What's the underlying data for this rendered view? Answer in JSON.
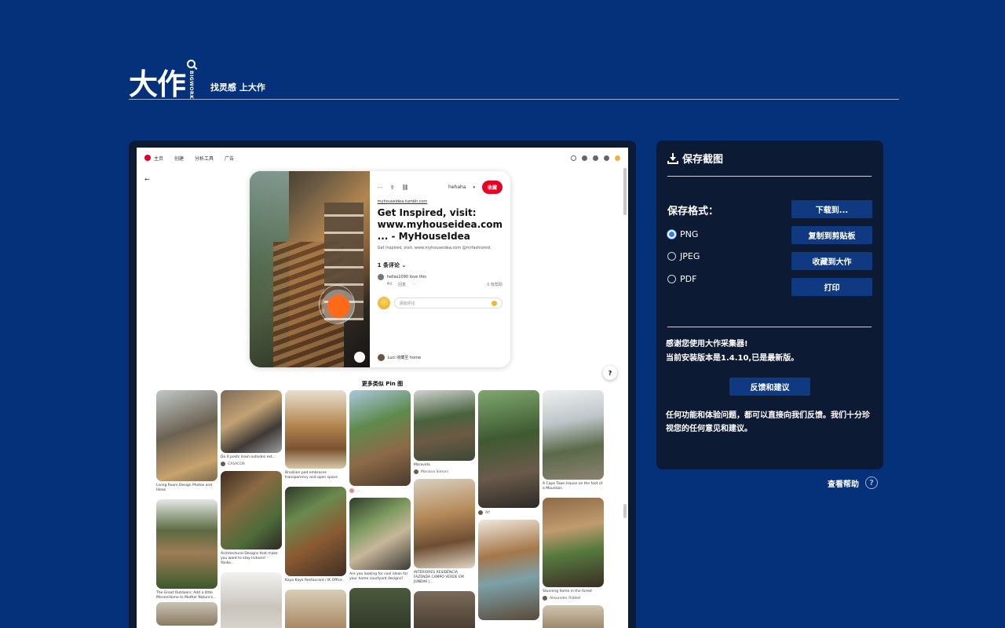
{
  "header": {
    "logo_text": "大作",
    "logo_vertical": "BIGWORK",
    "slogan": "找灵感 上大作"
  },
  "preview": {
    "topbar": {
      "nav": [
        "主页",
        "创建",
        "分析工具",
        "广告"
      ]
    },
    "pin": {
      "board": "hehaha",
      "save_label": "收藏",
      "link": "myhouseidea.tumblr.com",
      "title": "Get Inspired, visit: www.myhouseidea.com ... - MyHouseIdea",
      "description": "Get Inspired, visit: www.myhouseidea.com @mrfashionist",
      "comments_heading": "1 条评论",
      "comment_user": "hellas1090 love this",
      "comment_meta": [
        "4d",
        "回复"
      ],
      "comment_like": "0 有帮助",
      "add_placeholder": "添加评论",
      "owner": "Luci 收藏至 home"
    },
    "more_title": "更多类似 Pin 图",
    "grid": {
      "captions": [
        "Living Room Design Photos and Ideas",
        "The Great Outdoors: Add a little MissenHome to Mother Nature's...",
        "Do it posts main outsides ext...",
        "CASACOR",
        "Architectural Designs that make you want to stay Indoors! - Yanko...",
        "Brazilian pad embraces transparency and open space",
        "Kaya Kaya Restaurant / IK Office",
        "Are you looking for cool ideas for your home courtyard designs?",
        "Mariana Simoni",
        "Maravida",
        "INTERIORES RESIDÊNCIA FAZENDA CAMPO VERDE EM JUNDIAÍ |...",
        "Alf",
        "A Cape Town House on the foot of a Mountain",
        "Stunning home in the forest",
        "Alexander Riddell"
      ]
    }
  },
  "panel": {
    "title": "保存截图",
    "format_label": "保存格式：",
    "formats": [
      "PNG",
      "JPEG",
      "PDF"
    ],
    "selected_format": "PNG",
    "buttons": [
      "下载到...",
      "复制到剪贴板",
      "收藏到大作",
      "打印"
    ],
    "thanks_line1": "感谢您使用大作采集器!",
    "thanks_line2": "当前安装版本是1.4.10,已是最新版。",
    "feedback_label": "反馈和建议",
    "feedback_text": "任何功能和体验问题，都可以直接向我们反馈。我们十分珍视您的任何意见和建议。"
  },
  "help_label": "查看帮助",
  "colors": {
    "background": "#05317a",
    "panel": "#0c1a33",
    "button": "#0f3a82",
    "accent_red": "#e60023",
    "radio_on": "#2f7cf6"
  }
}
